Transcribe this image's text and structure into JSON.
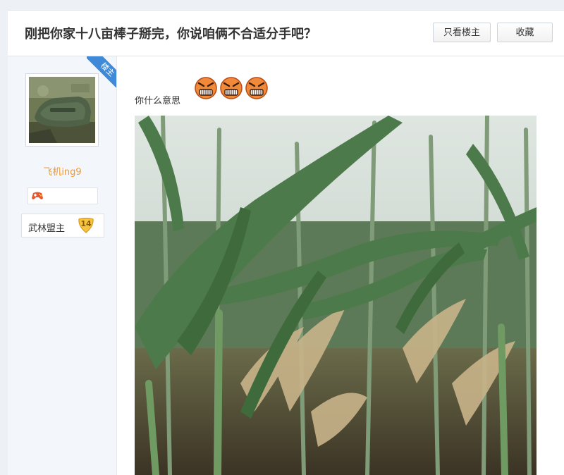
{
  "thread": {
    "title": "刚把你家十八亩棒子掰完，你说咱俩不合适分手吧？",
    "only_op_label": "只看楼主",
    "favorite_label": "收藏"
  },
  "author": {
    "op_ribbon": "楼主",
    "username": "飞机ing9",
    "rank": "武林盟主",
    "level": "14"
  },
  "post": {
    "text": "你什么意思",
    "emoji_icon": "angry-face-icon",
    "image_subject": "cornfield-photo"
  },
  "colors": {
    "username": "#f39a2d",
    "op_ribbon": "#3f8ad8",
    "level_badge": "#f5c542"
  }
}
